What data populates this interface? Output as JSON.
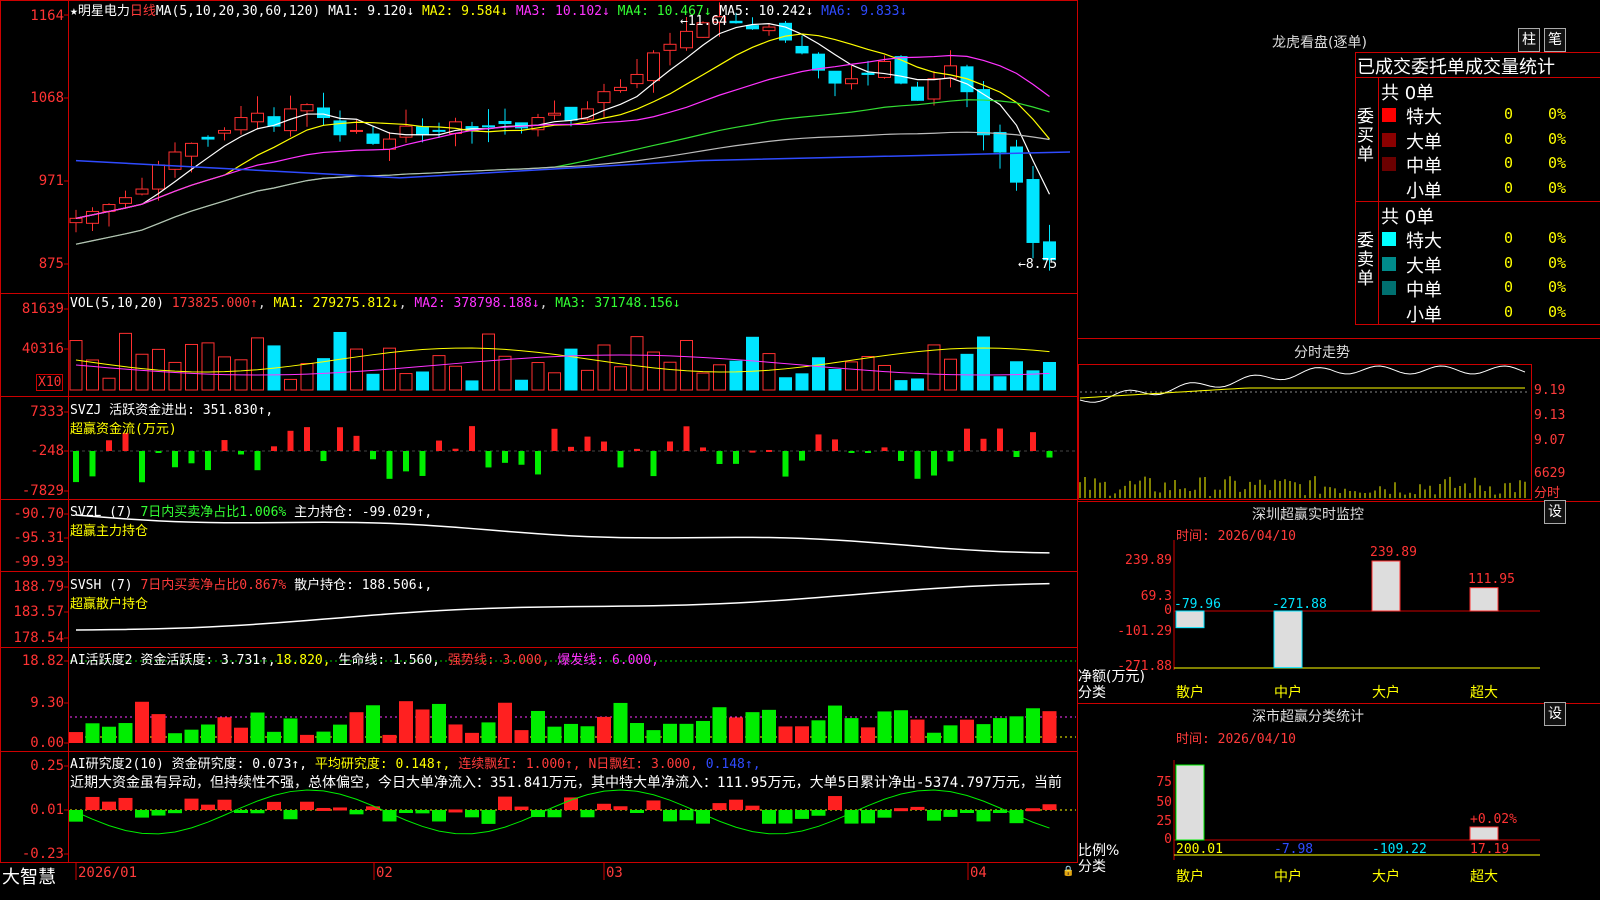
{
  "stock": {
    "star": "★",
    "name": "明星电力",
    "period": "日线"
  },
  "main": {
    "ma_title": "MA(5,10,20,30,60,120)",
    "ma1": "MA1: 9.120↓",
    "ma2": "MA2: 9.584↓",
    "ma3": "MA3: 10.102↓",
    "ma4": "MA4: 10.467↓",
    "ma5": "MA5: 10.242↓",
    "ma6": "MA6: 9.833↓",
    "y_ticks": [
      "1164",
      "1068",
      "971",
      "875"
    ],
    "high_label": "11.64",
    "low_label": "←8.75"
  },
  "vol": {
    "title": "VOL(5,10,20)",
    "value": "173825.000↑",
    "ma1": "MA1: 279275.812↓",
    "ma2": "MA2: 378798.188↓",
    "ma3": "MA3: 371748.156↓",
    "y_ticks": [
      "81639",
      "40316"
    ],
    "unit": "X10"
  },
  "svzj": {
    "title": "SVZJ",
    "desc": "活跃资金进出: 351.830↑,",
    "sub": "超赢资金流(万元)",
    "y_ticks": [
      "7333",
      "-248",
      "-7829"
    ]
  },
  "svzl": {
    "title": "SVZL (7)",
    "desc": "7日内买卖净占比1.006%",
    "hold": "主力持仓: -99.029↑,",
    "sub": "超赢主力持仓",
    "y_ticks": [
      "-90.70",
      "-95.31",
      "-99.93"
    ]
  },
  "svsh": {
    "title": "SVSH (7)",
    "desc": "7日内买卖净占比0.867%",
    "hold": "散户持仓: 188.506↓,",
    "sub": "超赢散户持仓",
    "y_ticks": [
      "188.79",
      "183.57",
      "178.54"
    ]
  },
  "ai1": {
    "title": "AI活跃度2",
    "a": "资金活跃度: 3.731↑,",
    "b": "18.820,",
    "c": "生命线: 1.560,",
    "d": "强势线: 3.000,",
    "e": "爆发线: 6.000,",
    "y_ticks": [
      "18.82",
      "9.30",
      "0.00"
    ]
  },
  "ai2": {
    "title": "AI研究度2(10)",
    "a": "资金研究度: 0.073↑,",
    "b": "平均研究度: 0.148↑,",
    "c": "连续飘红: 1.000↑,",
    "d": "N日飘红: 3.000,",
    "e": "0.148↑,",
    "text": "近期大资金虽有异动，但持续性不强，总体偏空，今日大单净流入：351.841万元，其中特大单净流入：111.95万元，大单5日累计净出-5374.797万元，当前",
    "y_ticks": [
      "0.25",
      "0.01",
      "-0.23"
    ]
  },
  "xaxis": {
    "brand": "大智慧",
    "labels": [
      "2026/01",
      "02",
      "03",
      "04"
    ]
  },
  "lhkp": {
    "title": "龙虎看盘(逐单)",
    "btn1": "柱",
    "btn2": "笔",
    "header": "已成交委托单成交量统计",
    "buy_label": "委买单",
    "sell_label": "委卖单",
    "buy_total": "共 0单",
    "sell_total": "共 0单",
    "rows": [
      {
        "name": "特大",
        "vol": "0",
        "pct": "0%"
      },
      {
        "name": "大单",
        "vol": "0",
        "pct": "0%"
      },
      {
        "name": "中单",
        "vol": "0",
        "pct": "0%"
      },
      {
        "name": "小单",
        "vol": "0",
        "pct": "0%"
      }
    ],
    "buy_colors": [
      "#ff0000",
      "#8b0000",
      "#6b0000",
      ""
    ],
    "sell_colors": [
      "#00ffff",
      "#008b8b",
      "#007070",
      ""
    ]
  },
  "fenshi": {
    "title": "分时走势",
    "prices": [
      "9.19",
      "9.13",
      "9.07"
    ],
    "vol": "6629",
    "vol_unit": "分时"
  },
  "monitor": {
    "title": "深圳超赢实时监控",
    "btn": "设",
    "time": "时间: 2026/04/10",
    "y_ticks": [
      "239.89",
      "69.3",
      "0",
      "-101.29",
      "-271.88"
    ],
    "ylabel": "净额(万元)",
    "xlabel": "分类",
    "cats": [
      "散户",
      "中户",
      "大户",
      "超大"
    ],
    "values": [
      -79.96,
      -271.88,
      239.89,
      111.95
    ],
    "value_labels": [
      "-79.96",
      "-271.88",
      "239.89",
      "111.95"
    ]
  },
  "classify": {
    "title": "深市超赢分类统计",
    "btn": "设",
    "time": "时间: 2026/04/10",
    "y_ticks": [
      "75",
      "50",
      "25",
      "0"
    ],
    "ylabel": "比例%",
    "xlabel": "分类",
    "cats": [
      "散户",
      "中户",
      "大户",
      "超大"
    ],
    "values": [
      "200.01",
      "-7.98",
      "-109.22",
      "17.19"
    ],
    "pct_label": "+0.02%"
  }
}
